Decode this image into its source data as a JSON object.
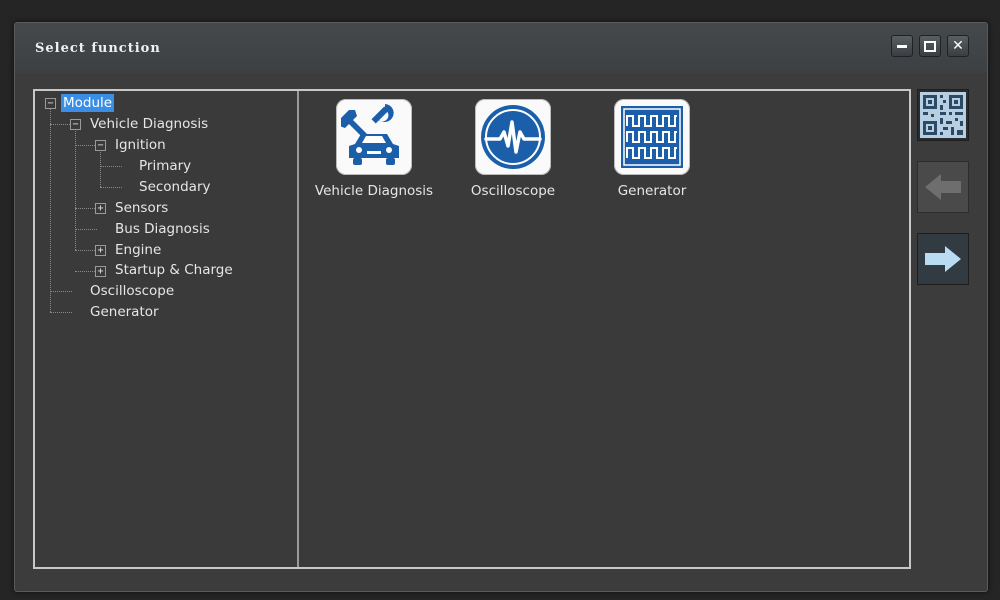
{
  "window": {
    "title": "Select function"
  },
  "titlebar_buttons": {
    "minimize": "minimize",
    "maximize": "maximize",
    "close": "✕"
  },
  "tree": {
    "root": "Module",
    "vehicle_diagnosis": "Vehicle Diagnosis",
    "ignition": "Ignition",
    "primary": "Primary",
    "secondary": "Secondary",
    "sensors": "Sensors",
    "bus_diagnosis": "Bus Diagnosis",
    "engine": "Engine",
    "startup_charge": "Startup & Charge",
    "oscilloscope": "Oscilloscope",
    "generator": "Generator"
  },
  "tiles": {
    "vehicle_diagnosis": {
      "label": "Vehicle Diagnosis",
      "icon": "car-wrench-icon"
    },
    "oscilloscope": {
      "label": "Oscilloscope",
      "icon": "waveform-icon"
    },
    "generator": {
      "label": "Generator",
      "icon": "square-wave-icon"
    }
  },
  "side_buttons": {
    "qr": "qr-code-icon",
    "back": "arrow-left-icon",
    "forward": "arrow-right-icon"
  },
  "colors": {
    "accent_blue": "#1b5faa",
    "selection": "#3a8ee6",
    "forward_arrow": "#b9dcf2"
  }
}
